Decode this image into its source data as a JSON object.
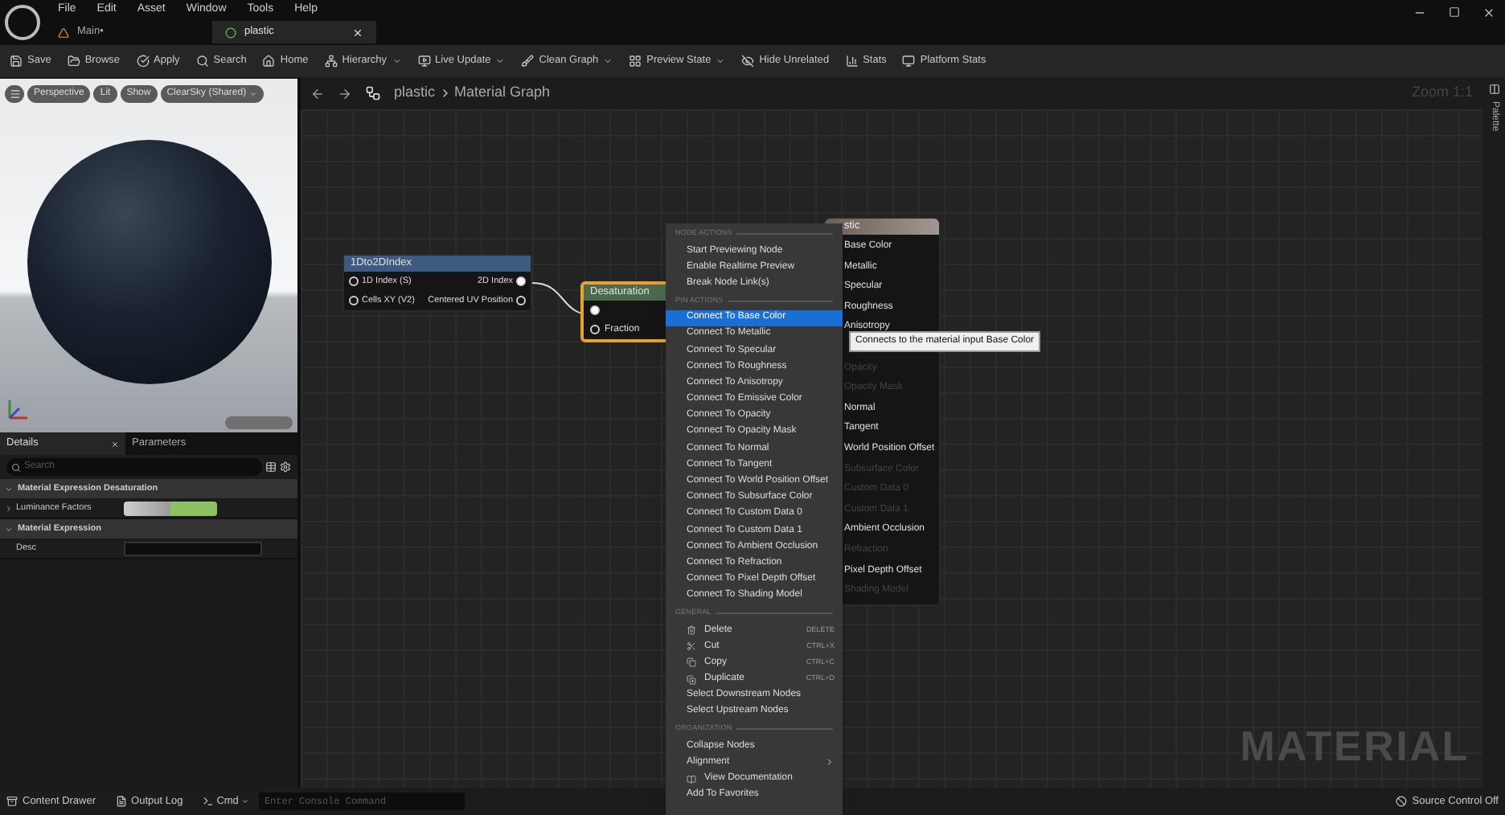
{
  "app_menu": [
    "File",
    "Edit",
    "Asset",
    "Window",
    "Tools",
    "Help"
  ],
  "doc_tabs": [
    {
      "label": "Main•",
      "kind": "level",
      "selected": false
    },
    {
      "label": "plastic",
      "kind": "material",
      "selected": true,
      "closable": true
    }
  ],
  "toolbar": [
    {
      "label": "Save",
      "kind": "save",
      "dropdown": false
    },
    {
      "label": "Browse",
      "kind": "browse",
      "dropdown": false
    },
    {
      "label": "Apply",
      "kind": "apply",
      "dropdown": false
    },
    {
      "label": "Search",
      "kind": "search",
      "dropdown": false
    },
    {
      "label": "Home",
      "kind": "home",
      "dropdown": false
    },
    {
      "label": "Hierarchy",
      "kind": "hierarchy",
      "dropdown": true
    },
    {
      "label": "Live Update",
      "kind": "live",
      "dropdown": true
    },
    {
      "label": "Clean Graph",
      "kind": "clean",
      "dropdown": true
    },
    {
      "label": "Preview State",
      "kind": "preview",
      "dropdown": true
    },
    {
      "label": "Hide Unrelated",
      "kind": "hide",
      "dropdown": false
    },
    {
      "label": "Stats",
      "kind": "stats",
      "dropdown": false
    },
    {
      "label": "Platform Stats",
      "kind": "platform",
      "dropdown": false
    }
  ],
  "viewport": {
    "buttons": [
      {
        "label": "Perspective",
        "dropdown": false
      },
      {
        "label": "Lit",
        "dropdown": false
      },
      {
        "label": "Show",
        "dropdown": false
      },
      {
        "label": "ClearSky (Shared)",
        "dropdown": true
      }
    ]
  },
  "details": {
    "tabs": [
      {
        "label": "Details",
        "selected": true
      },
      {
        "label": "Parameters",
        "selected": false
      }
    ],
    "search": {
      "placeholder": "Search"
    },
    "sections": [
      {
        "title": "Material Expression Desaturation",
        "expanded": true,
        "rows": [
          {
            "label": "Luminance Factors",
            "kind": "color",
            "expandable": true
          }
        ]
      },
      {
        "title": "Material Expression",
        "expanded": true,
        "rows": [
          {
            "label": "Desc",
            "kind": "text",
            "expandable": false
          }
        ]
      }
    ]
  },
  "graph": {
    "breadcrumb": [
      "plastic",
      "Material Graph"
    ],
    "zoom": "Zoom 1:1",
    "watermark": "MATERIAL",
    "palette_tab": "Palette",
    "nodes": [
      {
        "title": "1Dto2DIndex",
        "kind": "function",
        "selected": false,
        "rows": [
          {
            "input": "1D Index (S)",
            "output": "2D Index"
          },
          {
            "input": "Cells XY (V2)",
            "output": "Centered UV Position"
          }
        ]
      },
      {
        "title": "Desaturation",
        "kind": "expression",
        "selected": true,
        "rows": [
          {},
          {
            "input": "Fraction"
          }
        ]
      }
    ],
    "result_node": {
      "title": "stic",
      "pins": [
        {
          "label": "Base Color",
          "enabled": true
        },
        {
          "label": "Metallic",
          "enabled": true
        },
        {
          "label": "Specular",
          "enabled": true
        },
        {
          "label": "Roughness",
          "enabled": true
        },
        {
          "label": "Anisotropy",
          "enabled": true
        },
        {
          "label": "Opacity",
          "enabled": false
        },
        {
          "label": "Opacity Mask",
          "enabled": false
        },
        {
          "label": "Normal",
          "enabled": true
        },
        {
          "label": "Tangent",
          "enabled": true
        },
        {
          "label": "World Position Offset",
          "enabled": true
        },
        {
          "label": "Subsurface Color",
          "enabled": false
        },
        {
          "label": "Custom Data 0",
          "enabled": false
        },
        {
          "label": "Custom Data 1",
          "enabled": false
        },
        {
          "label": "Ambient Occlusion",
          "enabled": true
        },
        {
          "label": "Refraction",
          "enabled": false
        },
        {
          "label": "Pixel Depth Offset",
          "enabled": true
        },
        {
          "label": "Shading Model",
          "enabled": false
        }
      ]
    },
    "tooltip": "Connects to the material input Base Color"
  },
  "context_menu": [
    {
      "header": "NODE ACTIONS",
      "items": [
        {
          "label": "Start Previewing Node",
          "selected": false
        },
        {
          "label": "Enable Realtime Preview",
          "selected": false
        },
        {
          "label": "Break Node Link(s)",
          "selected": false
        }
      ]
    },
    {
      "header": "PIN ACTIONS",
      "items": [
        {
          "label": "Connect To Base Color",
          "selected": true
        },
        {
          "label": "Connect To Metallic",
          "selected": false
        },
        {
          "label": "Connect To Specular",
          "selected": false
        },
        {
          "label": "Connect To Roughness",
          "selected": false
        },
        {
          "label": "Connect To Anisotropy",
          "selected": false
        },
        {
          "label": "Connect To Emissive Color",
          "selected": false
        },
        {
          "label": "Connect To Opacity",
          "selected": false
        },
        {
          "label": "Connect To Opacity Mask",
          "selected": false
        },
        {
          "label": "Connect To Normal",
          "selected": false
        },
        {
          "label": "Connect To Tangent",
          "selected": false
        },
        {
          "label": "Connect To World Position Offset",
          "selected": false
        },
        {
          "label": "Connect To Subsurface Color",
          "selected": false
        },
        {
          "label": "Connect To Custom Data 0",
          "selected": false
        },
        {
          "label": "Connect To Custom Data 1",
          "selected": false
        },
        {
          "label": "Connect To Ambient Occlusion",
          "selected": false
        },
        {
          "label": "Connect To Refraction",
          "selected": false
        },
        {
          "label": "Connect To Pixel Depth Offset",
          "selected": false
        },
        {
          "label": "Connect To Shading Model",
          "selected": false
        }
      ]
    },
    {
      "header": "GENERAL",
      "items": [
        {
          "label": "Delete",
          "kind": "trash",
          "shortcut": "DELETE",
          "selected": false
        },
        {
          "label": "Cut",
          "kind": "cut",
          "shortcut": "CTRL+X",
          "selected": false
        },
        {
          "label": "Copy",
          "kind": "copy",
          "shortcut": "CTRL+C",
          "selected": false
        },
        {
          "label": "Duplicate",
          "kind": "duplicate",
          "shortcut": "CTRL+D",
          "selected": false
        },
        {
          "label": "Select Downstream Nodes",
          "selected": false
        },
        {
          "label": "Select Upstream Nodes",
          "selected": false
        }
      ]
    },
    {
      "header": "ORGANIZATION",
      "items": [
        {
          "label": "Collapse Nodes",
          "selected": false
        },
        {
          "label": "Alignment",
          "selected": false,
          "submenu": true
        },
        {
          "label": "View Documentation",
          "kind": "doc",
          "selected": false
        },
        {
          "label": "Add To Favorites",
          "selected": false
        }
      ]
    }
  ],
  "status_bar": {
    "left": [
      {
        "label": "Content Drawer",
        "kind": "drawer"
      },
      {
        "label": "Output Log",
        "kind": "log"
      }
    ],
    "cmd": {
      "label": "Cmd",
      "placeholder": "Enter Console Command"
    },
    "right": "Source Control Off"
  }
}
